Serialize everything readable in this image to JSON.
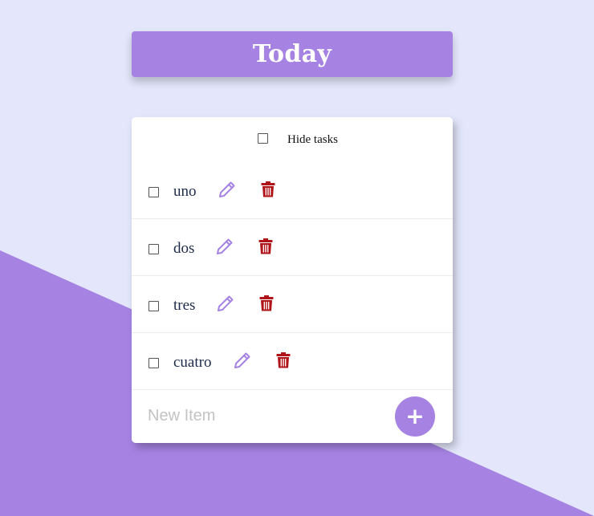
{
  "header": {
    "title": "Today"
  },
  "controls": {
    "hide_tasks_label": "Hide tasks",
    "hide_tasks_checked": false
  },
  "tasks": [
    {
      "label": "uno",
      "checked": false
    },
    {
      "label": "dos",
      "checked": false
    },
    {
      "label": "tres",
      "checked": false
    },
    {
      "label": "cuatro",
      "checked": false
    }
  ],
  "new_item": {
    "placeholder": "New Item",
    "value": "",
    "add_label": "+"
  },
  "icons": {
    "edit": "pencil-icon",
    "delete": "trash-icon",
    "add": "plus-icon"
  },
  "colors": {
    "background": "#e4e7fb",
    "accent": "#a683e3",
    "delete": "#b01318",
    "text": "#1d2b4a",
    "card": "#ffffff"
  }
}
